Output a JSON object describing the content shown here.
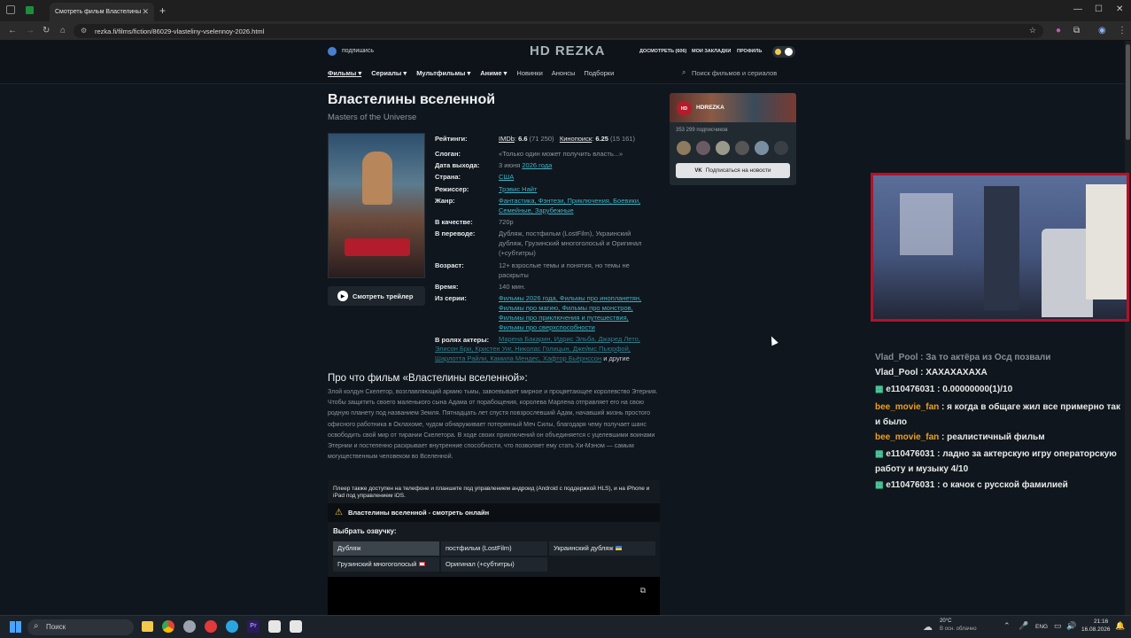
{
  "browser": {
    "tab_title": "Смотреть фильм Властелины вселенной",
    "url": "rezka.fi/films/fiction/86029-vlasteliny-vselennoy-2026.html",
    "tab_close": "✕",
    "tab_new": "+",
    "win_controls": [
      "—",
      "☐",
      "✕"
    ],
    "nav_icons": [
      "back-icon",
      "forward-icon",
      "reload-icon",
      "home-icon"
    ]
  },
  "site": {
    "subscribe": "подпишись",
    "logo": "HD REZKA",
    "lookslater": "ДОСМОТРЕТЬ",
    "lookslater_count": "606",
    "bookmarks": "МОИ ЗАКЛАДКИ",
    "profile": "ПРОФИЛЬ",
    "nav": [
      {
        "label": "Фильмы",
        "arrow": "▾"
      },
      {
        "label": "Сериалы",
        "arrow": "▾"
      },
      {
        "label": "Мультфильмы",
        "arrow": "▾"
      },
      {
        "label": "Аниме",
        "arrow": "▾"
      },
      {
        "label": "Новинки",
        "arrow": ""
      },
      {
        "label": "Анонсы",
        "arrow": ""
      },
      {
        "label": "Подборки",
        "arrow": ""
      }
    ],
    "search_placeholder": "Поиск фильмов и сериалов"
  },
  "film": {
    "title": "Властелины вселенной",
    "original_title": "Masters of the Universe",
    "trailer_btn": "Смотреть трейлер",
    "ratings_label": "Рейтинги:",
    "imdb": "IMDb",
    "imdb_score": "6.6",
    "imdb_votes": "(71 250)",
    "kp": "Кинопоиск",
    "kp_score": "6.25",
    "kp_votes": "(15 161)",
    "slogan_label": "Слоган:",
    "slogan": "«Только один может получить власть...»",
    "date_label": "Дата выхода:",
    "date_day": "3 июня",
    "date_year": "2026 года",
    "country_label": "Страна:",
    "country": "США",
    "director_label": "Режиссер:",
    "director": "Трэвис Найт",
    "genre_label": "Жанр:",
    "genre_line1": "Фантастика, Фэнтези, Приключения, Боевики,",
    "genre_line2": "Семейные, Зарубежные",
    "quality_label": "В качестве:",
    "quality": "720p",
    "translation_label": "В переводе:",
    "translation": "Дубляж, постфильм (LostFilm), Украинский дубляж, Грузинский многоголосый и Оригинал (+субтитры)",
    "age_label": "Возраст:",
    "age": "12+ взрослые темы и понятия, но темы не раскрыты",
    "time_label": "Время:",
    "time": "140 мин.",
    "series_label": "Из серии:",
    "series_lines": [
      "Фильмы 2026 года, Фильмы про инопланетян,",
      "Фильмы про магию, Фильмы про монстров,",
      "Фильмы про приключения и путешествия,",
      "Фильмы про сверхспособности"
    ],
    "actors_label": "В ролях актеры:",
    "actors_lines": [
      "Марена Бакарин, Идрис Эльба, Джаред Лето,",
      "Элисон Бри, Кристен Уиг, Николас Голицын, Джеймс Пьюрфой,",
      "Шарлотта Райли, Камила Мендес, Хафтор Бьёрнссон"
    ],
    "actors_more": "и другие",
    "about_title": "Про что фильм «Властелины вселенной»:",
    "about_text": "Злой колдун Скелетор, возглавляющий армию тьмы, завоевывает мирное и процветающее королевство Этерния. Чтобы защитить своего маленького сына Адама от порабощения, королева Марлена отправляет его на свою родную планету под названием Земля. Пятнадцать лет спустя повзрослевший Адам, начавший жизнь простого офисного работника в Оклахоме, чудом обнаруживает потерянный Меч Силы, благодаря чему получает шанс освободить свой мир от тирании Скелетора. В ходе своих приключений он объединяется с уцелевшими воинами Этернии и постепенно раскрывает внутренние способности, что позволяет ему стать Хи-Мэном — самым могущественным человеком во Вселенной.",
    "player_note": "Плеер также доступен на телефоне и планшете под управлением андроид (Android с поддержкой HLS), и на iPhone и iPad под управлением iOS.",
    "watch_title": "Властелины вселенной - смотреть онлайн",
    "dub_title": "Выбрать озвучку:",
    "dubs": [
      {
        "label": "Дубляж",
        "flag": ""
      },
      {
        "label": "постфильм (LostFilm)",
        "flag": ""
      },
      {
        "label": "Украинский дубляж",
        "flag": "ua"
      },
      {
        "label": "Грузинский многоголосый",
        "flag": "ge"
      },
      {
        "label": "Оригинал (+субтитры)",
        "flag": ""
      }
    ]
  },
  "vk_widget": {
    "name": "HDREZKA",
    "subs": "353 299 подписчиков",
    "btn": "Подписаться на новости"
  },
  "chat": [
    {
      "user": "Vlad_Pool",
      "user_color": "#8a8f95",
      "text": "За то актёра из Осд позвали",
      "text_color": "#8a8f95",
      "badge": false
    },
    {
      "user": "Vlad_Pool",
      "user_color": "#e9e9e9",
      "text": "ХАХАХАХАХА",
      "text_color": "#e9e9e9",
      "badge": false
    },
    {
      "user": "e110476031",
      "user_color": "#e9e9e9",
      "text": "0.00000000(1)/10",
      "text_color": "#e9e9e9",
      "badge": true
    },
    {
      "user": "bee_movie_fan",
      "user_color": "#f0a020",
      "text": "я когда в общаге жил все примерно так и было",
      "text_color": "#e9e9e9",
      "badge": false
    },
    {
      "user": "bee_movie_fan",
      "user_color": "#f0a020",
      "text": "реалистичный фильм",
      "text_color": "#e9e9e9",
      "badge": false
    },
    {
      "user": "e110476031",
      "user_color": "#e9e9e9",
      "text": "ладно за актерскую игру операторскую работу и музыку 4/10",
      "text_color": "#e9e9e9",
      "badge": true
    },
    {
      "user": "e110476031",
      "user_color": "#e9e9e9",
      "text": "о качок с русской фамилией",
      "text_color": "#e9e9e9",
      "badge": true
    }
  ],
  "taskbar": {
    "search": "Поиск",
    "temp": "20°C",
    "weather": "В осн. облачно",
    "lang": "ENG",
    "time": "21:16",
    "date": "16.08.2026"
  }
}
